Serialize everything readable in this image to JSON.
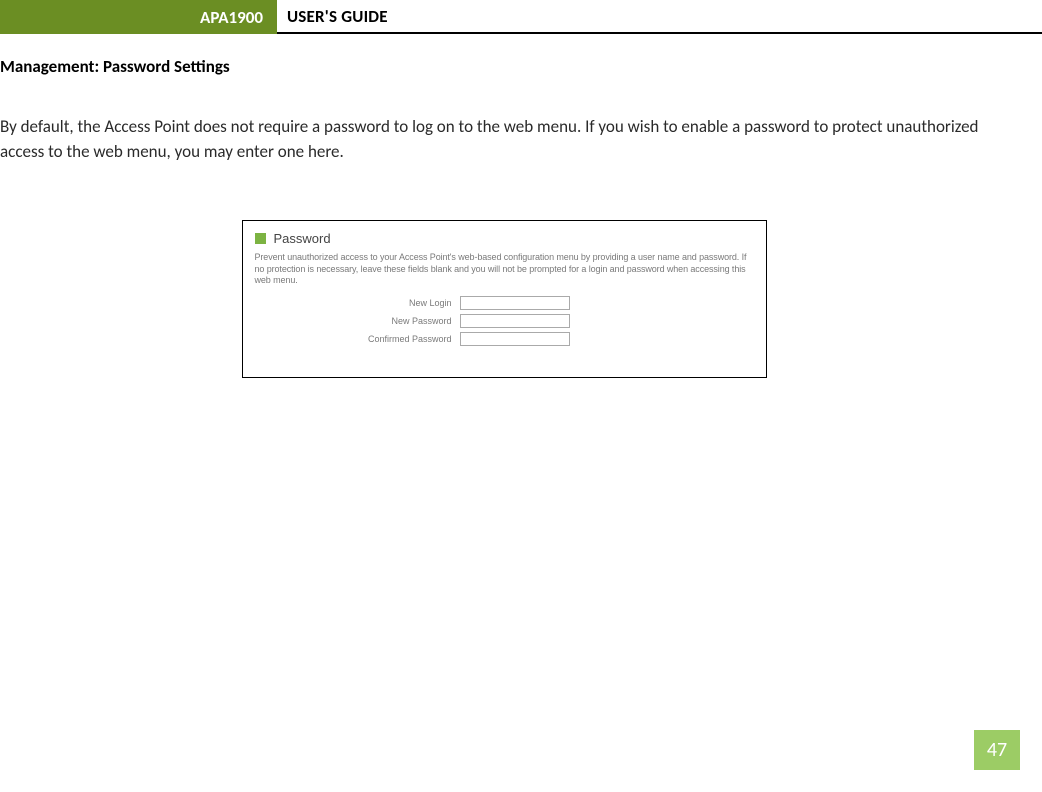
{
  "header": {
    "badge": "APA1900",
    "title": "USER'S GUIDE"
  },
  "section_heading": "Management: Password Settings",
  "intro_text": "By default, the Access Point does not require a password to log on to the web menu. If you wish to enable a password to protect unauthorized access to the web menu, you may enter one here.",
  "panel": {
    "title": "Password",
    "description": "Prevent unauthorized access to your Access Point's web-based configuration menu by providing a user name and password. If no protection is necessary, leave these fields blank and you will not be prompted for a login and password when accessing this web menu.",
    "fields": {
      "new_login_label": "New Login",
      "new_password_label": "New Password",
      "confirm_password_label": "Confirmed Password"
    }
  },
  "page_number": "47"
}
